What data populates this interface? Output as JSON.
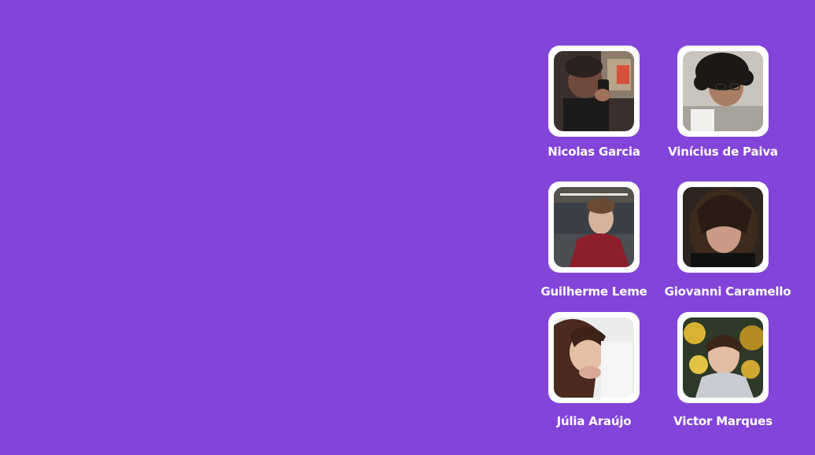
{
  "members": [
    {
      "name": "Nicolas Garcia"
    },
    {
      "name": "Vinícius de Paiva"
    },
    {
      "name": "Guilherme Leme"
    },
    {
      "name": "Giovanni Caramello"
    },
    {
      "name": "Júlia Araújo"
    },
    {
      "name": "Victor Marques"
    }
  ],
  "colors": {
    "background": "#8344DA",
    "card_frame": "#FFFFFF",
    "text": "#FFFFFF"
  }
}
